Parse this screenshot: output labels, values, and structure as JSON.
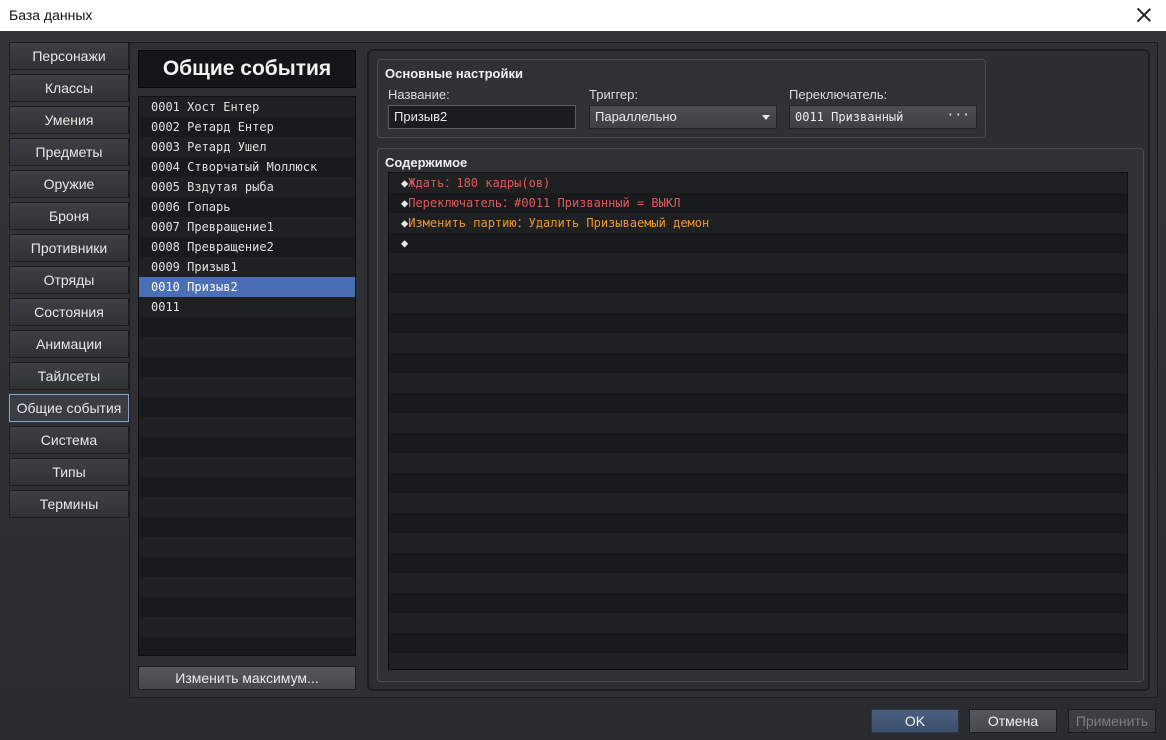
{
  "window": {
    "title": "База данных"
  },
  "tabs": [
    {
      "label": "Персонажи"
    },
    {
      "label": "Классы"
    },
    {
      "label": "Умения"
    },
    {
      "label": "Предметы"
    },
    {
      "label": "Оружие"
    },
    {
      "label": "Броня"
    },
    {
      "label": "Противники"
    },
    {
      "label": "Отряды"
    },
    {
      "label": "Состояния"
    },
    {
      "label": "Анимации"
    },
    {
      "label": "Тайлсеты"
    },
    {
      "label": "Общие события"
    },
    {
      "label": "Система"
    },
    {
      "label": "Типы"
    },
    {
      "label": "Термины"
    }
  ],
  "active_tab": "Общие события",
  "list": {
    "header": "Общие события",
    "items": [
      "0001 Хост Ентер",
      "0002 Ретард Ентер",
      "0003 Ретард Ушел",
      "0004 Створчатый Моллюск",
      "0005 Вздутая рыба",
      "0006 Гопарь",
      "0007 Превращение1",
      "0008 Превращение2",
      "0009 Призыв1",
      "0010 Призыв2",
      "0011"
    ],
    "selected": "0010 Призыв2",
    "change_max_label": "Изменить максимум..."
  },
  "basic": {
    "title": "Основные настройки",
    "name_label": "Название:",
    "name_value": "Призыв2",
    "trigger_label": "Триггер:",
    "trigger_value": "Параллельно",
    "switch_label": "Переключатель:",
    "switch_value": "0011 Призванный",
    "switch_dots": "···"
  },
  "content": {
    "title": "Содержимое",
    "commands": [
      {
        "text": "Ждать：180 кадры(ов)",
        "color": "#e0595b"
      },
      {
        "text": "Переключатель：#0011 Призванный = ВЫКЛ",
        "color": "#e0595b"
      },
      {
        "text": "Изменить партию：Удалить Призываемый демон",
        "color": "#f0962e"
      },
      {
        "text": "",
        "color": "#e8e8e8"
      }
    ]
  },
  "buttons": {
    "ok": "OK",
    "cancel": "Отмена",
    "apply": "Применить"
  }
}
